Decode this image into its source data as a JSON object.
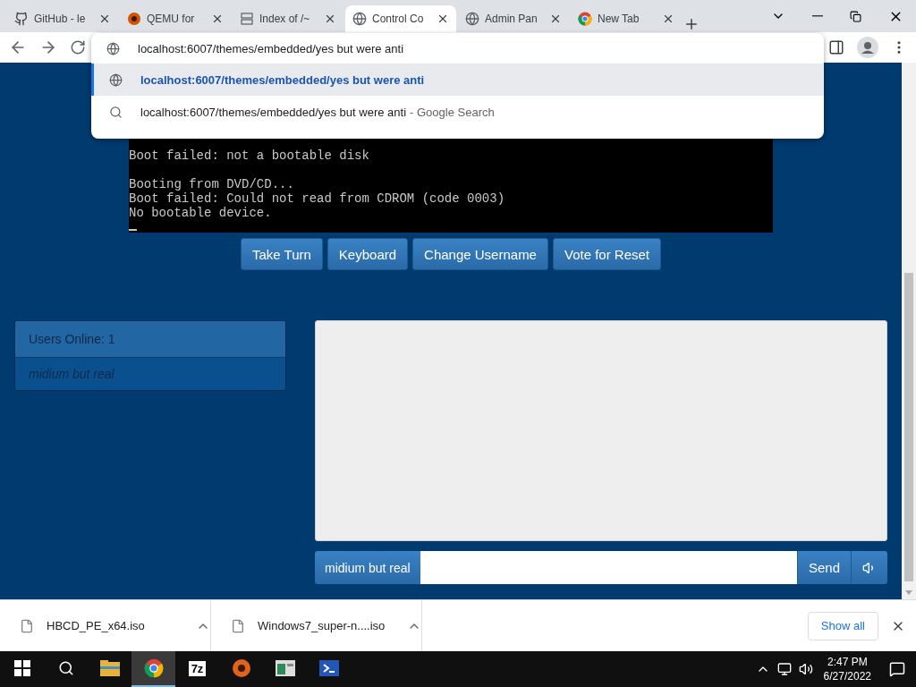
{
  "browser": {
    "tabs": [
      {
        "title": "GitHub - le",
        "kind": "github",
        "selected": false
      },
      {
        "title": "QEMU for",
        "kind": "qemu",
        "selected": false
      },
      {
        "title": "Index of /~",
        "kind": "index",
        "selected": false
      },
      {
        "title": "Control Co",
        "kind": "globe",
        "selected": true
      },
      {
        "title": "Admin Pan",
        "kind": "globe",
        "selected": false
      },
      {
        "title": "New Tab",
        "kind": "chrome",
        "selected": false
      }
    ],
    "address": "localhost:6007/themes/embedded/yes but were anti",
    "suggestions": [
      {
        "kind": "url",
        "text": "localhost:6007/themes/embedded/yes but were anti",
        "selected": true
      },
      {
        "kind": "search",
        "text": "localhost:6007/themes/embedded/yes but were anti",
        "hint": "- Google Search",
        "selected": false
      }
    ]
  },
  "terminal": {
    "blocks": [
      [
        "Boot failed: not a bootable disk"
      ],
      [
        "Booting from DVD/CD...",
        "Boot failed: Could not read from CDROM (code 0003)",
        "No bootable device."
      ]
    ]
  },
  "controls": [
    "Take Turn",
    "Keyboard",
    "Change Username",
    "Vote for Reset"
  ],
  "users": {
    "header": "Users Online: 1",
    "list": [
      "midium but real"
    ]
  },
  "chat": {
    "username": "midium but real",
    "send": "Send"
  },
  "downloads": {
    "items": [
      "HBCD_PE_x64.iso",
      "Windows7_super-n....iso"
    ],
    "show_all": "Show all"
  },
  "taskbar": {
    "apps": [
      {
        "kind": "folder",
        "selected": false
      },
      {
        "kind": "chrome",
        "selected": true
      },
      {
        "kind": "sevenzip",
        "label": "7z",
        "selected": false
      },
      {
        "kind": "qemu",
        "selected": false
      },
      {
        "kind": "window",
        "selected": false
      },
      {
        "kind": "shell",
        "selected": false
      }
    ],
    "time": "2:47 PM",
    "date": "6/27/2022"
  }
}
